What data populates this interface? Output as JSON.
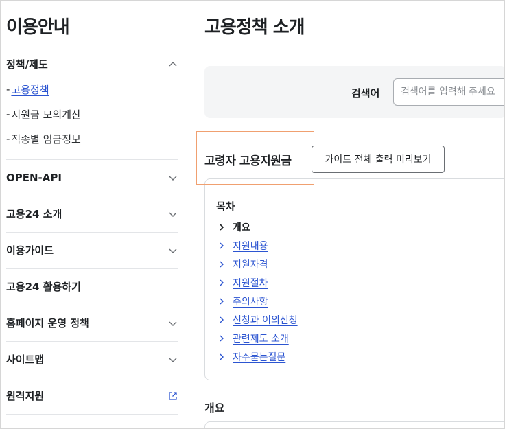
{
  "sidebar": {
    "title": "이용안내",
    "policy": {
      "label": "정책/제도",
      "items": [
        {
          "label": "고용정책",
          "active": true
        },
        {
          "label": "지원금 모의계산"
        },
        {
          "label": "직종별 임금정보"
        }
      ],
      "dash": "-"
    },
    "groups": [
      {
        "label": "OPEN-API",
        "icon": "chevron-down-icon"
      },
      {
        "label": "고용24 소개",
        "icon": "chevron-down-icon"
      },
      {
        "label": "이용가이드",
        "icon": "chevron-down-icon"
      },
      {
        "label": "고용24 활용하기"
      },
      {
        "label": "홈페이지 운영 정책",
        "icon": "chevron-down-icon"
      },
      {
        "label": "사이트맵",
        "icon": "chevron-down-icon"
      },
      {
        "label": "원격지원",
        "icon": "external-link-icon"
      }
    ]
  },
  "main": {
    "page_title": "고용정책 소개",
    "search": {
      "label": "검색어",
      "placeholder": "검색어를 입력해 주세요"
    },
    "section_title": "고령자 고용지원금",
    "print_button": "가이드 전체 출력 미리보기",
    "toc": {
      "title": "목차",
      "items": [
        "개요",
        "지원내용",
        "지원자격",
        "지원절차",
        "주의사항",
        "신청과 이의신청",
        "관련제도 소개",
        "자주묻는질문"
      ]
    },
    "overview_title": "개요"
  },
  "colors": {
    "link": "#2c55d1",
    "highlight": "#f0a070",
    "search_bg": "#f4f5f6"
  }
}
